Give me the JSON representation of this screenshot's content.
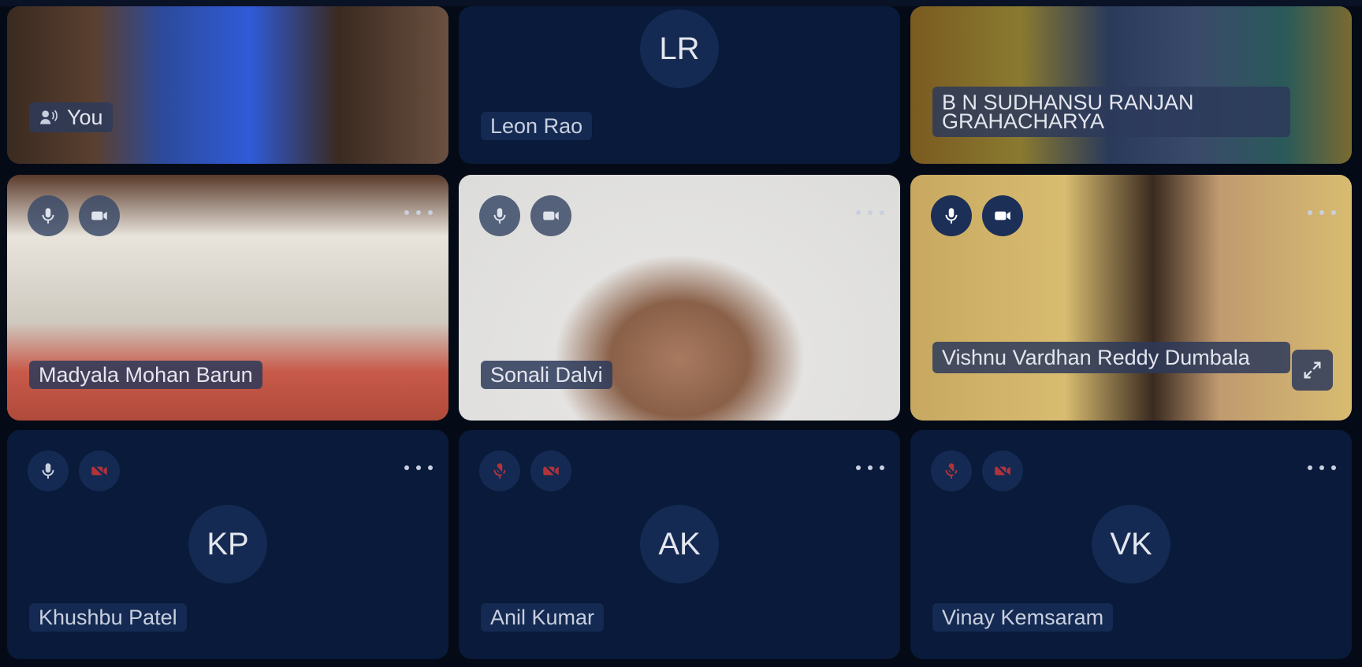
{
  "tiles": {
    "you": {
      "label": "You"
    },
    "leon": {
      "initials": "LR",
      "name": "Leon Rao"
    },
    "bn": {
      "name": "B N SUDHANSU RANJAN GRAHACHARYA"
    },
    "madyala": {
      "name": "Madyala Mohan Barun"
    },
    "sonali": {
      "name": "Sonali Dalvi"
    },
    "vishnu": {
      "name": "Vishnu Vardhan Reddy Dumbala"
    },
    "khushbu": {
      "initials": "KP",
      "name": "Khushbu Patel"
    },
    "anil": {
      "initials": "AK",
      "name": "Anil Kumar"
    },
    "vinay": {
      "initials": "VK",
      "name": "Vinay Kemsaram"
    }
  },
  "icons": {
    "mic": "microphone-icon",
    "mic_off": "microphone-off-icon",
    "cam": "camera-icon",
    "cam_off": "camera-off-icon",
    "more": "more-options-icon",
    "expand": "expand-icon",
    "speaker": "speaker-icon"
  },
  "colors": {
    "background": "#050a17",
    "tile": "#091a3a",
    "muted_red": "#b0333b"
  }
}
